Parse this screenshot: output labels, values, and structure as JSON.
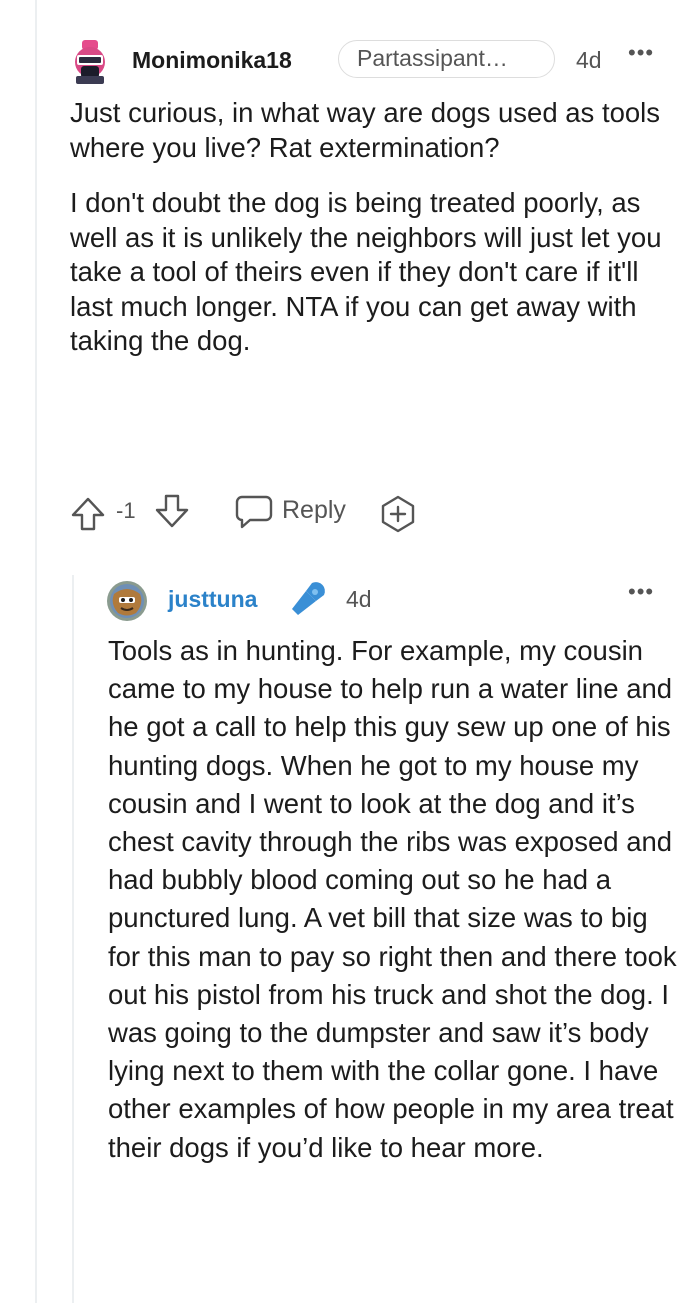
{
  "comment": {
    "username": "Monimonika18",
    "flair": "Partassipant…",
    "age": "4d",
    "more": "•••",
    "paragraphs": [
      "Just curious, in what way are dogs used as tools where you live? Rat extermination?",
      "I don't doubt the dog is being treated poorly, as well as it is unlikely the neighbors will just let you take a tool of theirs even if they don't care if it'll last much longer. NTA if you can get away with taking the dog."
    ],
    "actions": {
      "upvote_icon": "arrow-up-outline-icon",
      "vote_count": "-1",
      "downvote_icon": "arrow-down-outline-icon",
      "reply_icon": "speech-bubble-icon",
      "reply_label": "Reply",
      "award_icon": "plus-circle-icon"
    }
  },
  "reply": {
    "username": "justtuna",
    "badge_icon": "microphone-icon",
    "age": "4d",
    "more": "•••",
    "text": "Tools as in hunting. For example, my cousin came to my house to help run a water line and he got a call to help this guy sew up one of his hunting dogs. When he got to my house my cousin and I went to look at the dog and it’s chest cavity through the ribs was exposed and had bubbly blood coming out so he had a punctured lung. A vet bill that size was to big for this man to pay so right then and there took out his pistol from his truck and shot the dog. I was going to the dumpster and saw it’s body lying next to them with the collar gone. I have other examples of how people in my area treat their dogs if you’d like to hear more."
  },
  "colors": {
    "username_link": "#2b82c9",
    "mic_badge": "#3a8fd6",
    "meta_text": "#555555",
    "thread_line": "#eceff1"
  }
}
